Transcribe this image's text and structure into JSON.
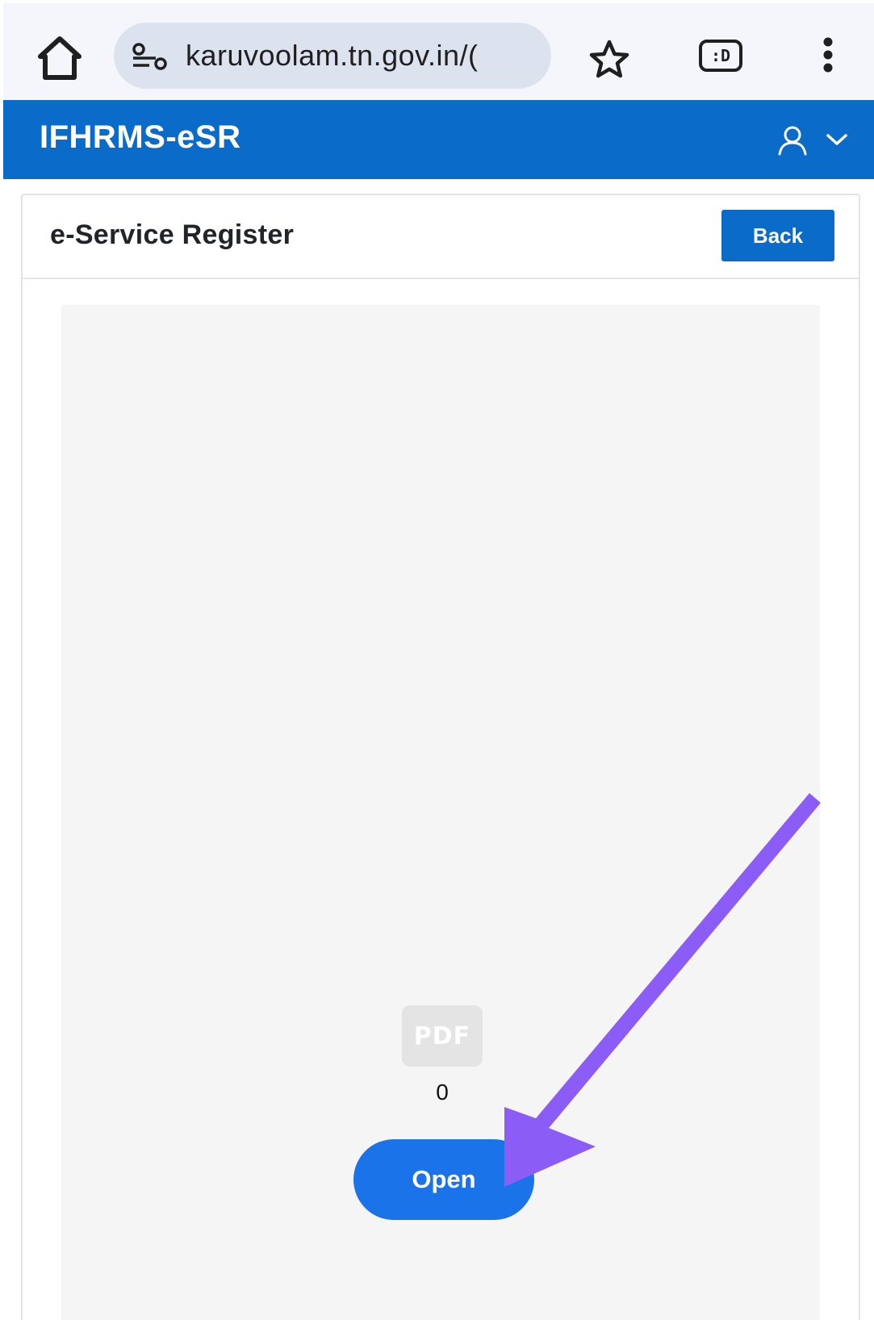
{
  "browser": {
    "url": "karuvoolam.tn.gov.in/(",
    "tabs_label": ":D",
    "icons": {
      "home": "home-icon",
      "site_info": "site-info-icon",
      "bookmark": "star-icon",
      "tabs": "tab-switcher-icon",
      "menu": "more-vert-icon"
    }
  },
  "header": {
    "title": "IFHRMS-eSR",
    "icons": {
      "account": "user-icon",
      "dropdown": "chevron-down-icon"
    }
  },
  "card": {
    "title": "e-Service Register",
    "back_label": "Back"
  },
  "viewer": {
    "pdf_label": "PDF",
    "page_count": "0",
    "open_label": "Open"
  },
  "colors": {
    "header_bg": "#0b6bc9",
    "back_button": "#0b6bc9",
    "open_button": "#1a73e8",
    "annotation_arrow": "#8b5cf6",
    "viewer_bg": "#f5f5f5",
    "omnibox_bg": "#dde3ee"
  }
}
